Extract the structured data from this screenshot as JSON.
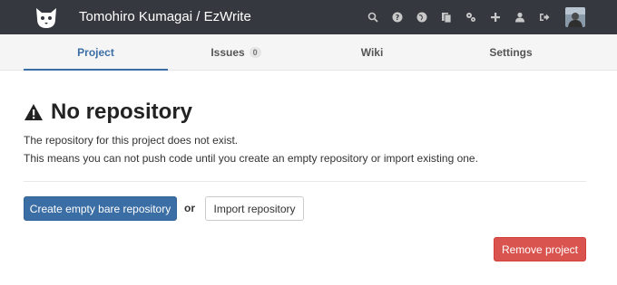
{
  "header": {
    "title": "Tomohiro Kumagai / EzWrite",
    "nav_icons": [
      "search-icon",
      "help-icon",
      "globe-icon",
      "files-icon",
      "settings-icon",
      "plus-icon",
      "user-icon",
      "sign-out-icon"
    ]
  },
  "tabs": [
    {
      "label": "Project",
      "active": true
    },
    {
      "label": "Issues",
      "badge": "0",
      "active": false
    },
    {
      "label": "Wiki",
      "active": false
    },
    {
      "label": "Settings",
      "active": false
    }
  ],
  "main": {
    "heading": "No repository",
    "line1": "The repository for this project does not exist.",
    "line2": "This means you can not push code until you create an empty repository or import existing one.",
    "create_button": "Create empty bare repository",
    "or_text": "or",
    "import_button": "Import repository",
    "remove_button": "Remove project"
  },
  "colors": {
    "header_bg": "#35393f",
    "accent": "#3b6ea5",
    "danger": "#d9534f"
  }
}
